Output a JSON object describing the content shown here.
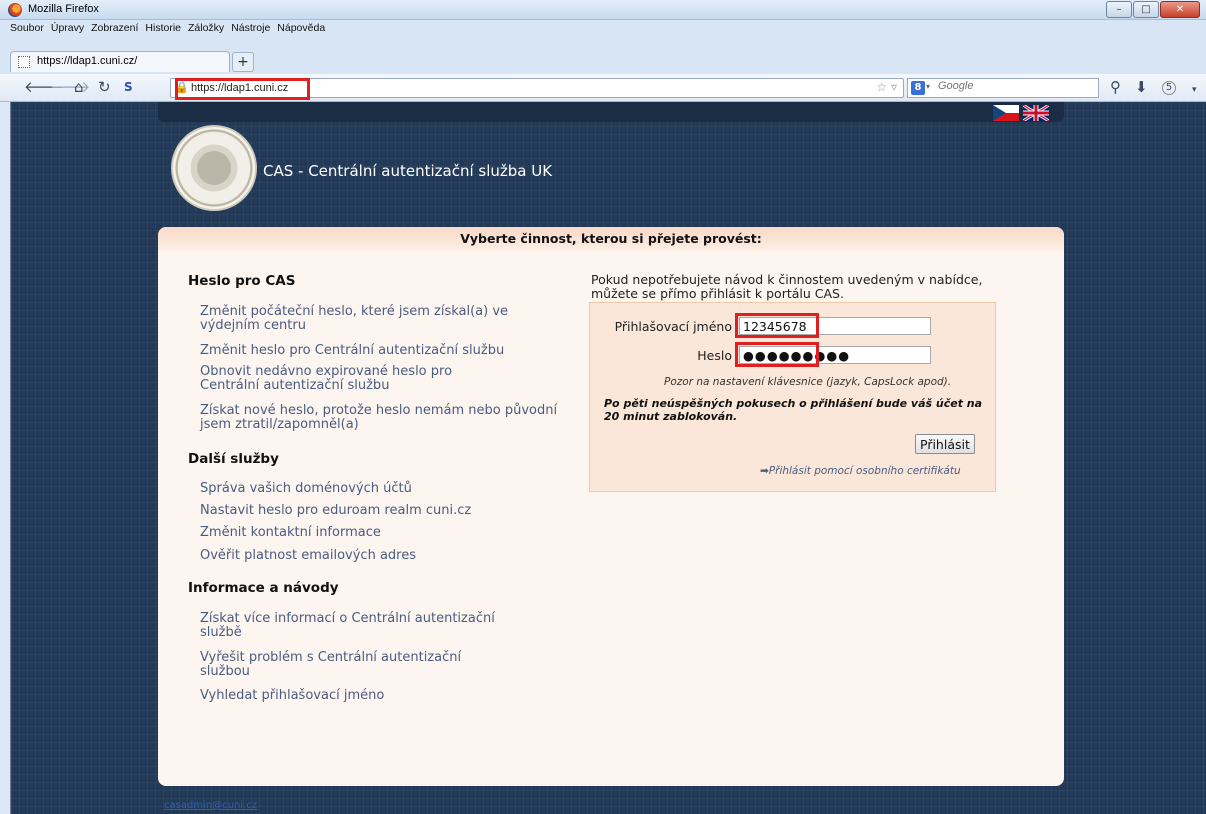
{
  "window": {
    "title": "Mozilla Firefox",
    "controls": {
      "minimize": "–",
      "maximize": "□",
      "close": "✕"
    }
  },
  "menubar": {
    "items": [
      "Soubor",
      "Úpravy",
      "Zobrazení",
      "Historie",
      "Záložky",
      "Nástroje",
      "Nápověda"
    ]
  },
  "tabs": [
    {
      "label": "https://ldap1.cuni.cz/"
    }
  ],
  "newtab_label": "+",
  "navbar": {
    "url": "https://ldap1.cuni.cz",
    "search_placeholder": "Google",
    "search_engine_letter": "8",
    "downloads_count": "5"
  },
  "page": {
    "site_title": "CAS - Centrální autentizační služba UK",
    "panel_header": "Vyberte činnost, kterou si přejete provést:",
    "sections": [
      {
        "title": "Heslo pro CAS",
        "links": [
          "Změnit počáteční heslo, které jsem získal(a) ve výdejním centru",
          "Změnit heslo pro Centrální autentizační službu",
          "Obnovit nedávno expirované heslo pro Centrální autentizační službu",
          "Získat nové heslo, protože heslo nemám nebo původní jsem ztratil/zapomněl(a)"
        ]
      },
      {
        "title": "Další služby",
        "links": [
          "Správa vašich doménových účtů",
          "Nastavit heslo pro eduroam realm cuni.cz",
          "Změnit kontaktní informace",
          "Ověřit platnost emailových adres"
        ]
      },
      {
        "title": "Informace a návody",
        "links": [
          "Získat více informací o Centrální autentizační službě",
          "Vyřešit problém s Centrální autentizační službou",
          "Vyhledat přihlašovací jméno"
        ]
      }
    ],
    "login": {
      "intro": "Pokud nepotřebujete návod k činnostem uvedeným v nabídce, můžete se přímo přihlásit k portálu CAS.",
      "username_label": "Přihlašovací jméno",
      "username_value": "12345678",
      "password_label": "Heslo",
      "password_value": "●●●●●●●●●",
      "keyboard_note": "Pozor na nastavení klávesnice (jazyk, CapsLock apod).",
      "lockout_warning": "Po pěti neúspěšných pokusech o přihlášení bude váš účet na 20 minut zablokován.",
      "submit_label": "Přihlásit",
      "cert_link": "➡Přihlásit pomocí osobního certifikátu"
    },
    "footer_email": "casadmin@cuni.cz"
  },
  "colors": {
    "page_bg": "#223a58",
    "panel_bg": "#fcf5f0",
    "link": "#4a5c80",
    "highlight": "#e02020"
  }
}
